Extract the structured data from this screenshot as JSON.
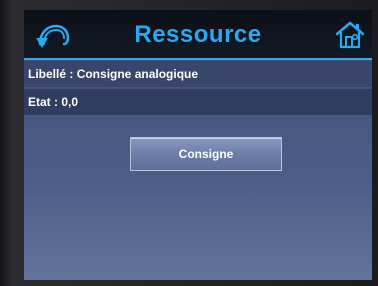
{
  "header": {
    "title": "Ressource",
    "back_icon": "back-arrow-icon",
    "home_icon": "home-icon"
  },
  "fields": {
    "libelle_label": "Libellé : ",
    "libelle_value": "Consigne analogique",
    "etat_label": "Etat : ",
    "etat_value": "0,0"
  },
  "actions": {
    "consigne_label": "Consigne"
  },
  "colors": {
    "title": "#2ba9f0",
    "header_line": "#3aa6e8",
    "screen_bg": "#45577f",
    "button_bg": "#6e80aa"
  }
}
